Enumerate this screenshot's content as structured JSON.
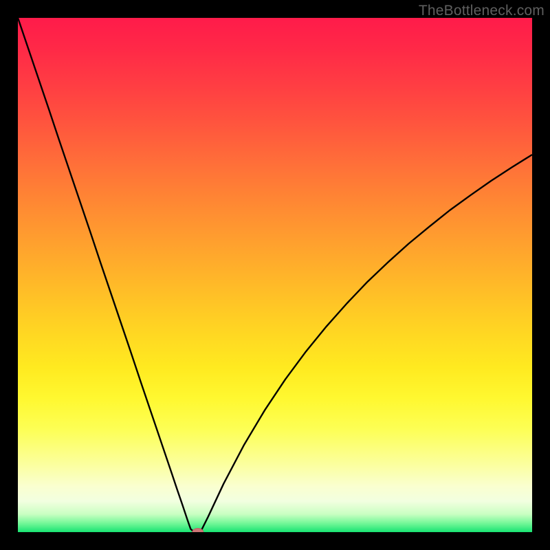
{
  "watermark": "TheBottleneck.com",
  "colors": {
    "frame": "#000000",
    "curve": "#000000",
    "marker_fill": "#ce7576",
    "marker_stroke": "#b96263"
  },
  "chart_data": {
    "type": "line",
    "title": "",
    "xlabel": "",
    "ylabel": "",
    "xlim": [
      0,
      100
    ],
    "ylim": [
      0,
      100
    ],
    "grid": false,
    "legend": false,
    "gradient_stops": [
      {
        "pos": 0.0,
        "color": "#ff1b4a"
      },
      {
        "pos": 0.06,
        "color": "#ff2947"
      },
      {
        "pos": 0.13,
        "color": "#ff3d43"
      },
      {
        "pos": 0.2,
        "color": "#ff533e"
      },
      {
        "pos": 0.28,
        "color": "#ff6e39"
      },
      {
        "pos": 0.36,
        "color": "#ff8833"
      },
      {
        "pos": 0.44,
        "color": "#ffa12e"
      },
      {
        "pos": 0.52,
        "color": "#ffba28"
      },
      {
        "pos": 0.6,
        "color": "#ffd323"
      },
      {
        "pos": 0.68,
        "color": "#ffea20"
      },
      {
        "pos": 0.74,
        "color": "#fff830"
      },
      {
        "pos": 0.8,
        "color": "#fdff55"
      },
      {
        "pos": 0.87,
        "color": "#fbffa0"
      },
      {
        "pos": 0.91,
        "color": "#faffcf"
      },
      {
        "pos": 0.94,
        "color": "#f2ffe0"
      },
      {
        "pos": 0.965,
        "color": "#c9ffc2"
      },
      {
        "pos": 0.982,
        "color": "#78f89a"
      },
      {
        "pos": 1.0,
        "color": "#18e472"
      }
    ],
    "series": [
      {
        "name": "bottleneck-curve",
        "x": [
          0,
          2,
          4,
          6,
          8,
          10,
          12,
          14,
          16,
          18,
          20,
          22,
          24,
          26,
          28,
          30,
          31,
          32,
          33,
          33.6,
          34.3,
          35.5,
          37,
          40,
          44,
          48,
          52,
          56,
          60,
          64,
          68,
          72,
          76,
          80,
          84,
          88,
          92,
          96,
          100
        ],
        "y": [
          100,
          94.1,
          88.2,
          82.3,
          76.3,
          70.4,
          64.5,
          58.6,
          52.6,
          46.7,
          40.8,
          34.9,
          28.9,
          23.0,
          17.1,
          11.2,
          8.2,
          5.3,
          2.3,
          0.6,
          0.0,
          0.0,
          3.0,
          9.4,
          17.0,
          23.7,
          29.7,
          35.1,
          40.0,
          44.5,
          48.7,
          52.5,
          56.1,
          59.4,
          62.6,
          65.5,
          68.3,
          70.9,
          73.4
        ]
      }
    ],
    "marker": {
      "x": 35.0,
      "y": 0.0
    }
  }
}
